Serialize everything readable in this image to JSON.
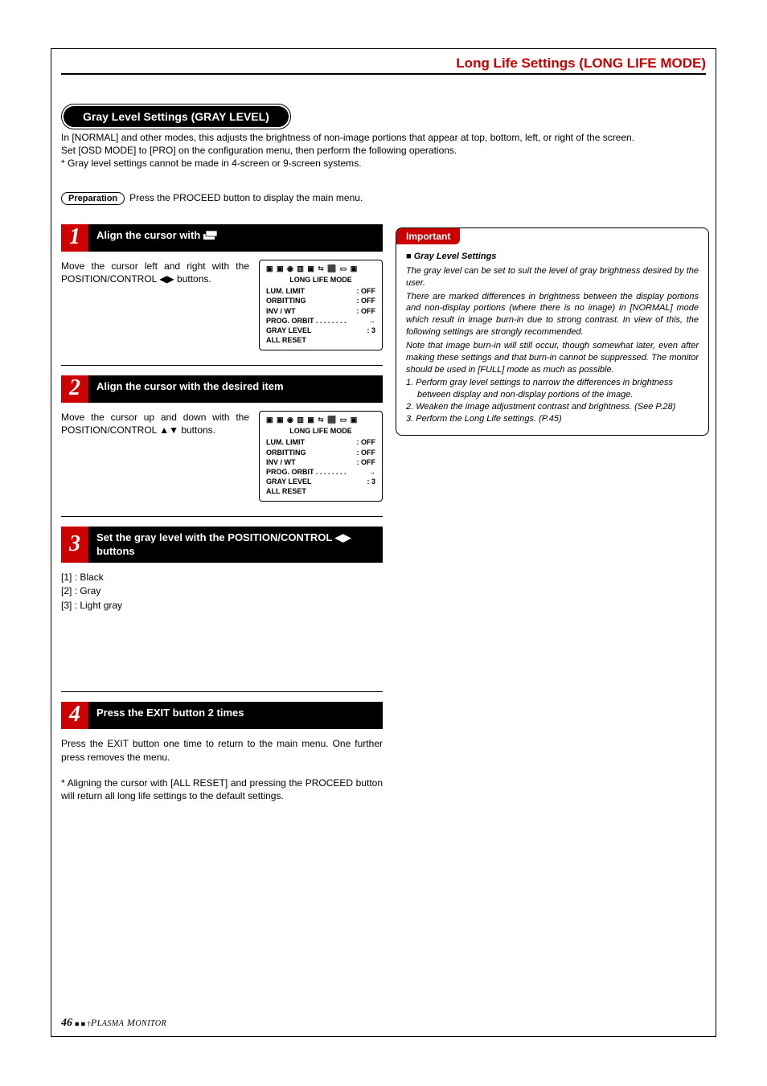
{
  "header": {
    "title": "Long Life Settings (LONG LIFE MODE)"
  },
  "section_pill": "Gray Level Settings (GRAY LEVEL)",
  "intro": {
    "line1": "In [NORMAL] and other modes, this adjusts the brightness of non-image portions that appear at top, bottom, left, or right of the screen.",
    "line2": "Set [OSD MODE] to [PRO] on the configuration menu, then perform the following operations.",
    "line3": "*  Gray level settings cannot be made in 4-screen or 9-screen systems."
  },
  "preparation": {
    "label": "Preparation",
    "text": "Press the PROCEED button to display the main menu."
  },
  "steps": [
    {
      "num": "1",
      "title_prefix": "Align the cursor with ",
      "desc": "Move the cursor left and right with the POSITION/CONTROL ◀▶ buttons.",
      "osd": {
        "title": "LONG LIFE MODE",
        "rows": [
          {
            "l": "LUM. LIMIT",
            "r": ": OFF"
          },
          {
            "l": "ORBITTING",
            "r": ": OFF"
          },
          {
            "l": "INV / WT",
            "r": ": OFF"
          },
          {
            "l": "PROG. ORBIT  . . . . . . . .",
            "r": "→"
          },
          {
            "l": "GRAY LEVEL",
            "r": ": 3"
          },
          {
            "l": "ALL RESET",
            "r": ""
          }
        ]
      }
    },
    {
      "num": "2",
      "title": "Align the cursor with the desired item",
      "desc": "Move the cursor up and down with the POSITION/CONTROL ▲▼ buttons.",
      "osd": {
        "title": "LONG LIFE MODE",
        "rows": [
          {
            "l": "LUM. LIMIT",
            "r": ": OFF"
          },
          {
            "l": "ORBITTING",
            "r": ": OFF"
          },
          {
            "l": "INV / WT",
            "r": ": OFF"
          },
          {
            "l": "PROG. ORBIT  . . . . . . . .",
            "r": "→"
          },
          {
            "l": "GRAY LEVEL",
            "r": ": 3"
          },
          {
            "l": "ALL RESET",
            "r": ""
          }
        ]
      }
    },
    {
      "num": "3",
      "title": "Set the gray level with the POSITION/CONTROL ◀▶ buttons",
      "options": [
        "[1] : Black",
        "[2] : Gray",
        "[3] : Light gray"
      ]
    },
    {
      "num": "4",
      "title": "Press the EXIT button 2 times",
      "body1": "Press the EXIT button one time to return to the main menu. One further press removes the menu.",
      "body2": "* Aligning the cursor with [ALL RESET] and pressing the PROCEED button will return all long life settings to the default settings."
    }
  ],
  "important": {
    "tab": "Important",
    "heading": "Gray Level Settings",
    "p1": "The gray level can be set to suit the level of gray brightness desired by the user.",
    "p2": "There are marked differences in brightness between the display portions and non-display portions (where there is no image) in [NORMAL] mode which result in image burn-in due to strong contrast. In view of this, the following settings are strongly recommended.",
    "p3": "Note that image burn-in will still occur, though somewhat later, even after making these settings and that burn-in cannot be suppressed. The monitor should be used in [FULL] mode as much as possible.",
    "list": [
      "1. Perform gray level settings to narrow the differences in brightness between display and non-display portions of the image.",
      "2. Weaken the image adjustment contrast and brightness. (See P.28)",
      "3. Perform the Long Life settings. (P.45)"
    ]
  },
  "footer": {
    "page": "46",
    "brand": "Plasma Monitor"
  },
  "osd_icons": "▣ ▣ ◉ ▥ ▣ ⮀ ⬛ ▭ ▣"
}
